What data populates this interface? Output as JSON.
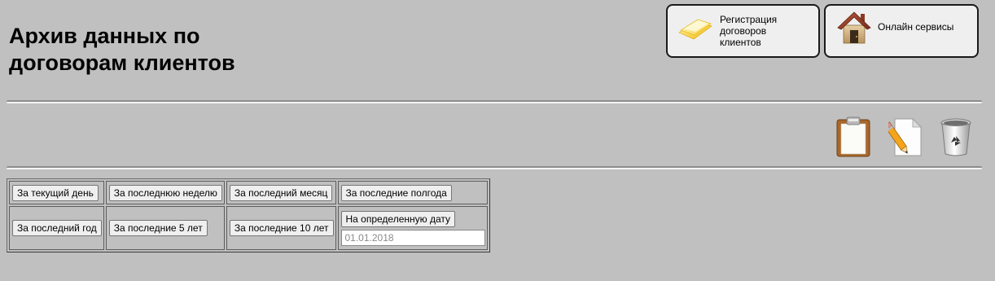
{
  "page": {
    "title_line1": "Архив данных по",
    "title_line2": "договорам клиентов"
  },
  "header_buttons": {
    "register": {
      "label": "Регистрация\nдоговоров\nклиентов",
      "icon": "contract-papers-icon"
    },
    "online": {
      "label": "Онлайн сервисы",
      "icon": "home-icon"
    }
  },
  "toolbar": {
    "icons": [
      "clipboard-icon",
      "pencil-document-icon",
      "recycle-bin-icon"
    ]
  },
  "periods": {
    "row1": [
      "За текущий день",
      "За последнюю неделю",
      "За последний месяц",
      "За последние полгода"
    ],
    "row2": [
      "За последний год",
      "За последние 5 лет",
      "За последние 10 лет"
    ],
    "specific_date_label": "На определенную дату",
    "date_placeholder": "01.01.2018"
  },
  "colors": {
    "background": "#c0c0c0",
    "button_face": "#efefef",
    "button_border": "#1a1a1a"
  }
}
